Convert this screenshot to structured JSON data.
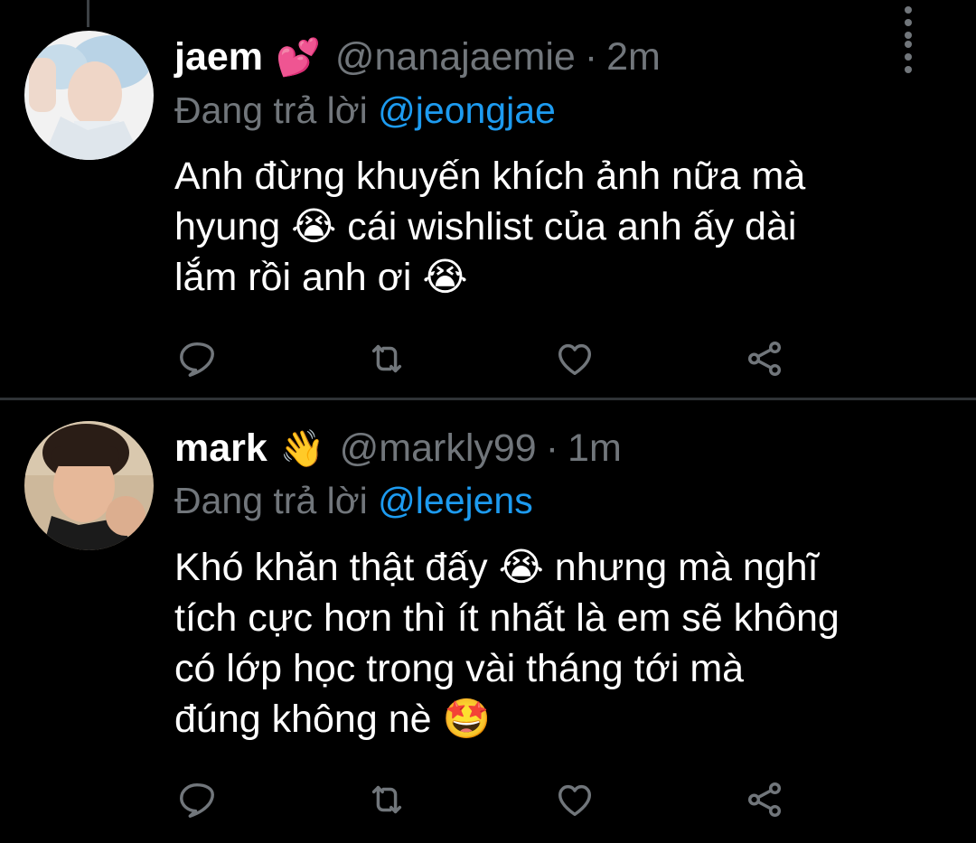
{
  "colors": {
    "background": "#000000",
    "primary_text": "#ffffff",
    "secondary_text": "#71767b",
    "mention": "#1d9bf0",
    "divider": "#2f3336"
  },
  "tweets": [
    {
      "display_name": "jaem",
      "name_emoji": "💕",
      "handle": "@nanajaemie",
      "separator": "·",
      "time": "2m",
      "replying_prefix": "Đang trả lời",
      "replying_to": "@jeongjae",
      "lines": [
        "Anh đừng khuyến khích ảnh nữa mà",
        "hyung 😭 cái wishlist của anh ấy dài",
        "lắm rồi anh ơi 😭"
      ],
      "icons": [
        "reply-icon",
        "retweet-icon",
        "like-icon",
        "share-icon",
        "more-icon"
      ]
    },
    {
      "display_name": "mark",
      "name_emoji": "👋",
      "handle": "@markly99",
      "separator": "·",
      "time": "1m",
      "replying_prefix": "Đang trả lời",
      "replying_to": "@leejens",
      "lines": [
        "Khó khăn thật đấy 😭 nhưng mà nghĩ",
        "tích cực hơn thì ít nhất là em sẽ không",
        "có lớp học trong vài tháng tới mà",
        "đúng không nè 🤩"
      ],
      "icons": [
        "reply-icon",
        "retweet-icon",
        "like-icon",
        "share-icon",
        "more-icon"
      ]
    }
  ]
}
